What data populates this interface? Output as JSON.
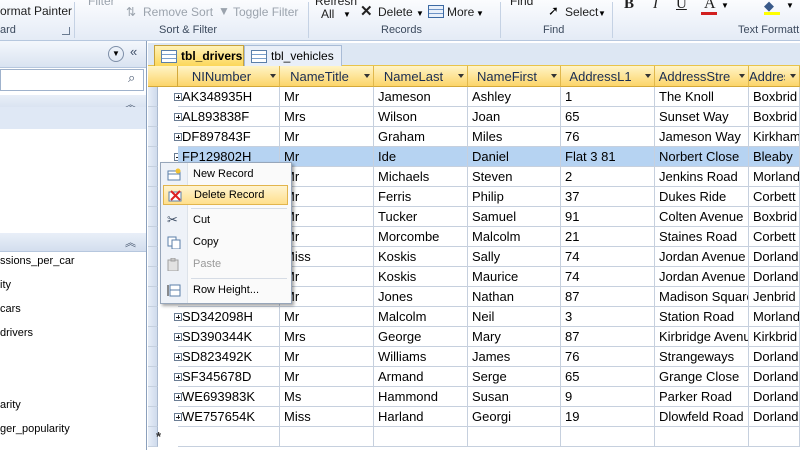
{
  "ribbon": {
    "format_painter": "ormat Painter",
    "filter": "Filter",
    "remove_sort": "Remove Sort",
    "toggle_filter": "Toggle Filter",
    "refresh": "Refresh",
    "all": "All",
    "delete": "Delete",
    "more": "More",
    "find": "Find",
    "select": "Select",
    "bold": "B",
    "italic": "I",
    "underline": "U",
    "font_color": "A",
    "group_clipboard": "ard",
    "group_sort_filter": "Sort & Filter",
    "group_records": "Records",
    "group_find": "Find",
    "group_text_formatting": "Text Formatt"
  },
  "nav": {
    "items": [
      "ssions_per_car",
      "ity",
      "cars",
      "drivers",
      "arity",
      "ger_popularity"
    ]
  },
  "tabs": [
    {
      "label": "tbl_drivers",
      "active": true
    },
    {
      "label": "tbl_vehicles",
      "active": false
    }
  ],
  "grid": {
    "columns": [
      "NINumber",
      "NameTitle",
      "NameLast",
      "NameFirst",
      "AddressL1",
      "AddressStre",
      "Address"
    ],
    "rows": [
      [
        "AK348935H",
        "Mr",
        "Jameson",
        "Ashley",
        "1",
        "The Knoll",
        "Boxbrid"
      ],
      [
        "AL893838F",
        "Mrs",
        "Wilson",
        "Joan",
        "65",
        "Sunset Way",
        "Boxbrid"
      ],
      [
        "DF897843F",
        "Mr",
        "Graham",
        "Miles",
        "76",
        "Jameson Way",
        "Kirkham"
      ],
      [
        "FP129802H",
        "Mr",
        "Ide",
        "Daniel",
        "Flat 3 81",
        "Norbert Close",
        "Bleaby"
      ],
      [
        "",
        "Mr",
        "Michaels",
        "Steven",
        "2",
        "Jenkins Road",
        "Morland"
      ],
      [
        "",
        "Mr",
        "Ferris",
        "Philip",
        "37",
        "Dukes Ride",
        "Corbett"
      ],
      [
        "",
        "Mr",
        "Tucker",
        "Samuel",
        "91",
        "Colten Avenue",
        "Boxbrid"
      ],
      [
        "",
        "Mr",
        "Morcombe",
        "Malcolm",
        "21",
        "Staines Road",
        "Corbett"
      ],
      [
        "",
        "Miss",
        "Koskis",
        "Sally",
        "74",
        "Jordan Avenue",
        "Dorland"
      ],
      [
        "",
        "Mr",
        "Koskis",
        "Maurice",
        "74",
        "Jordan Avenue",
        "Dorland"
      ],
      [
        "",
        "Mr",
        "Jones",
        "Nathan",
        "87",
        "Madison Square",
        "Jenbrid"
      ],
      [
        "SD342098H",
        "Mr",
        "Malcolm",
        "Neil",
        "3",
        "Station Road",
        "Morland"
      ],
      [
        "SD390344K",
        "Mrs",
        "George",
        "Mary",
        "87",
        "Kirbridge Avenue",
        "Kirkbrid"
      ],
      [
        "SD823492K",
        "Mr",
        "Williams",
        "James",
        "76",
        "Strangeways",
        "Dorland"
      ],
      [
        "SF345678D",
        "Mr",
        "Armand",
        "Serge",
        "65",
        "Grange Close",
        "Dorland"
      ],
      [
        "WE693983K",
        "Ms",
        "Hammond",
        "Susan",
        "9",
        "Parker Road",
        "Dorland"
      ],
      [
        "WE757654K",
        "Miss",
        "Harland",
        "Georgi",
        "19",
        "Dlowfeld Road",
        "Dorland"
      ]
    ],
    "new_row_marker": "*"
  },
  "context_menu": {
    "items": [
      {
        "label": "New Record",
        "icon": "new-record-icon"
      },
      {
        "label": "Delete Record",
        "icon": "delete-record-icon"
      },
      {
        "label": "Cut",
        "icon": "scissors-icon"
      },
      {
        "label": "Copy",
        "icon": "copy-icon"
      },
      {
        "label": "Paste",
        "icon": "paste-icon"
      },
      {
        "label": "Row Height...",
        "icon": "row-height-icon"
      }
    ]
  }
}
